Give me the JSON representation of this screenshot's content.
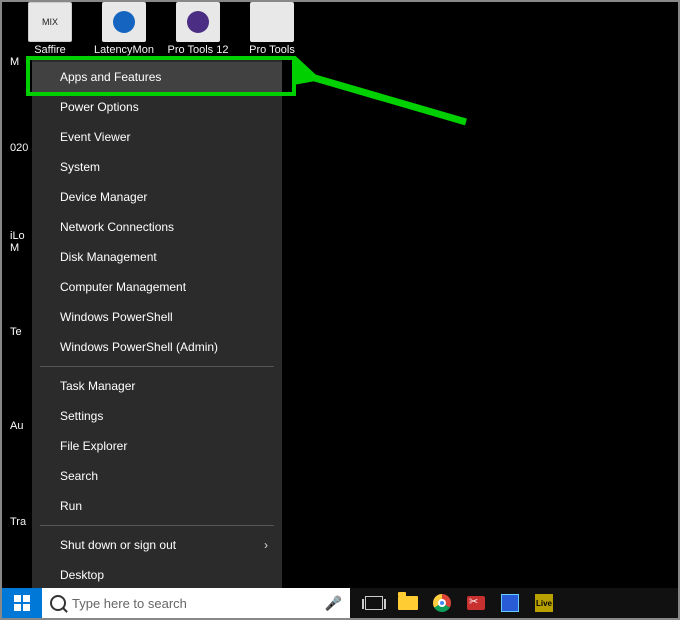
{
  "desktop_icons": [
    {
      "label": "Saffire",
      "cls": "di-mix"
    },
    {
      "label": "LatencyMon",
      "cls": "di-latency"
    },
    {
      "label": "Pro Tools 12",
      "cls": "di-pt"
    },
    {
      "label": "Pro Tools",
      "cls": "di-pt2"
    }
  ],
  "left_fragments": [
    "M",
    "020",
    "iLo\nM",
    "Te",
    "Au",
    "Tra"
  ],
  "winx_menu": {
    "groups": [
      [
        {
          "label": "Apps and Features",
          "hover": true
        },
        {
          "label": "Power Options"
        },
        {
          "label": "Event Viewer"
        },
        {
          "label": "System"
        },
        {
          "label": "Device Manager"
        },
        {
          "label": "Network Connections"
        },
        {
          "label": "Disk Management"
        },
        {
          "label": "Computer Management"
        },
        {
          "label": "Windows PowerShell"
        },
        {
          "label": "Windows PowerShell (Admin)"
        }
      ],
      [
        {
          "label": "Task Manager"
        },
        {
          "label": "Settings"
        },
        {
          "label": "File Explorer"
        },
        {
          "label": "Search"
        },
        {
          "label": "Run"
        }
      ],
      [
        {
          "label": "Shut down or sign out",
          "submenu": true
        },
        {
          "label": "Desktop"
        }
      ]
    ]
  },
  "search": {
    "placeholder": "Type here to search"
  },
  "taskbar_icons": [
    {
      "name": "task-view-icon",
      "cls": "ic-taskview"
    },
    {
      "name": "file-explorer-icon",
      "cls": "ic-folder"
    },
    {
      "name": "chrome-icon",
      "cls": "ic-chrome"
    },
    {
      "name": "snip-icon",
      "cls": "ic-snip"
    },
    {
      "name": "app-blue-icon",
      "cls": "ic-blue"
    },
    {
      "name": "ableton-live-icon",
      "cls": "ic-live",
      "text": "Live"
    }
  ],
  "annotation": {
    "color": "#00d000"
  }
}
